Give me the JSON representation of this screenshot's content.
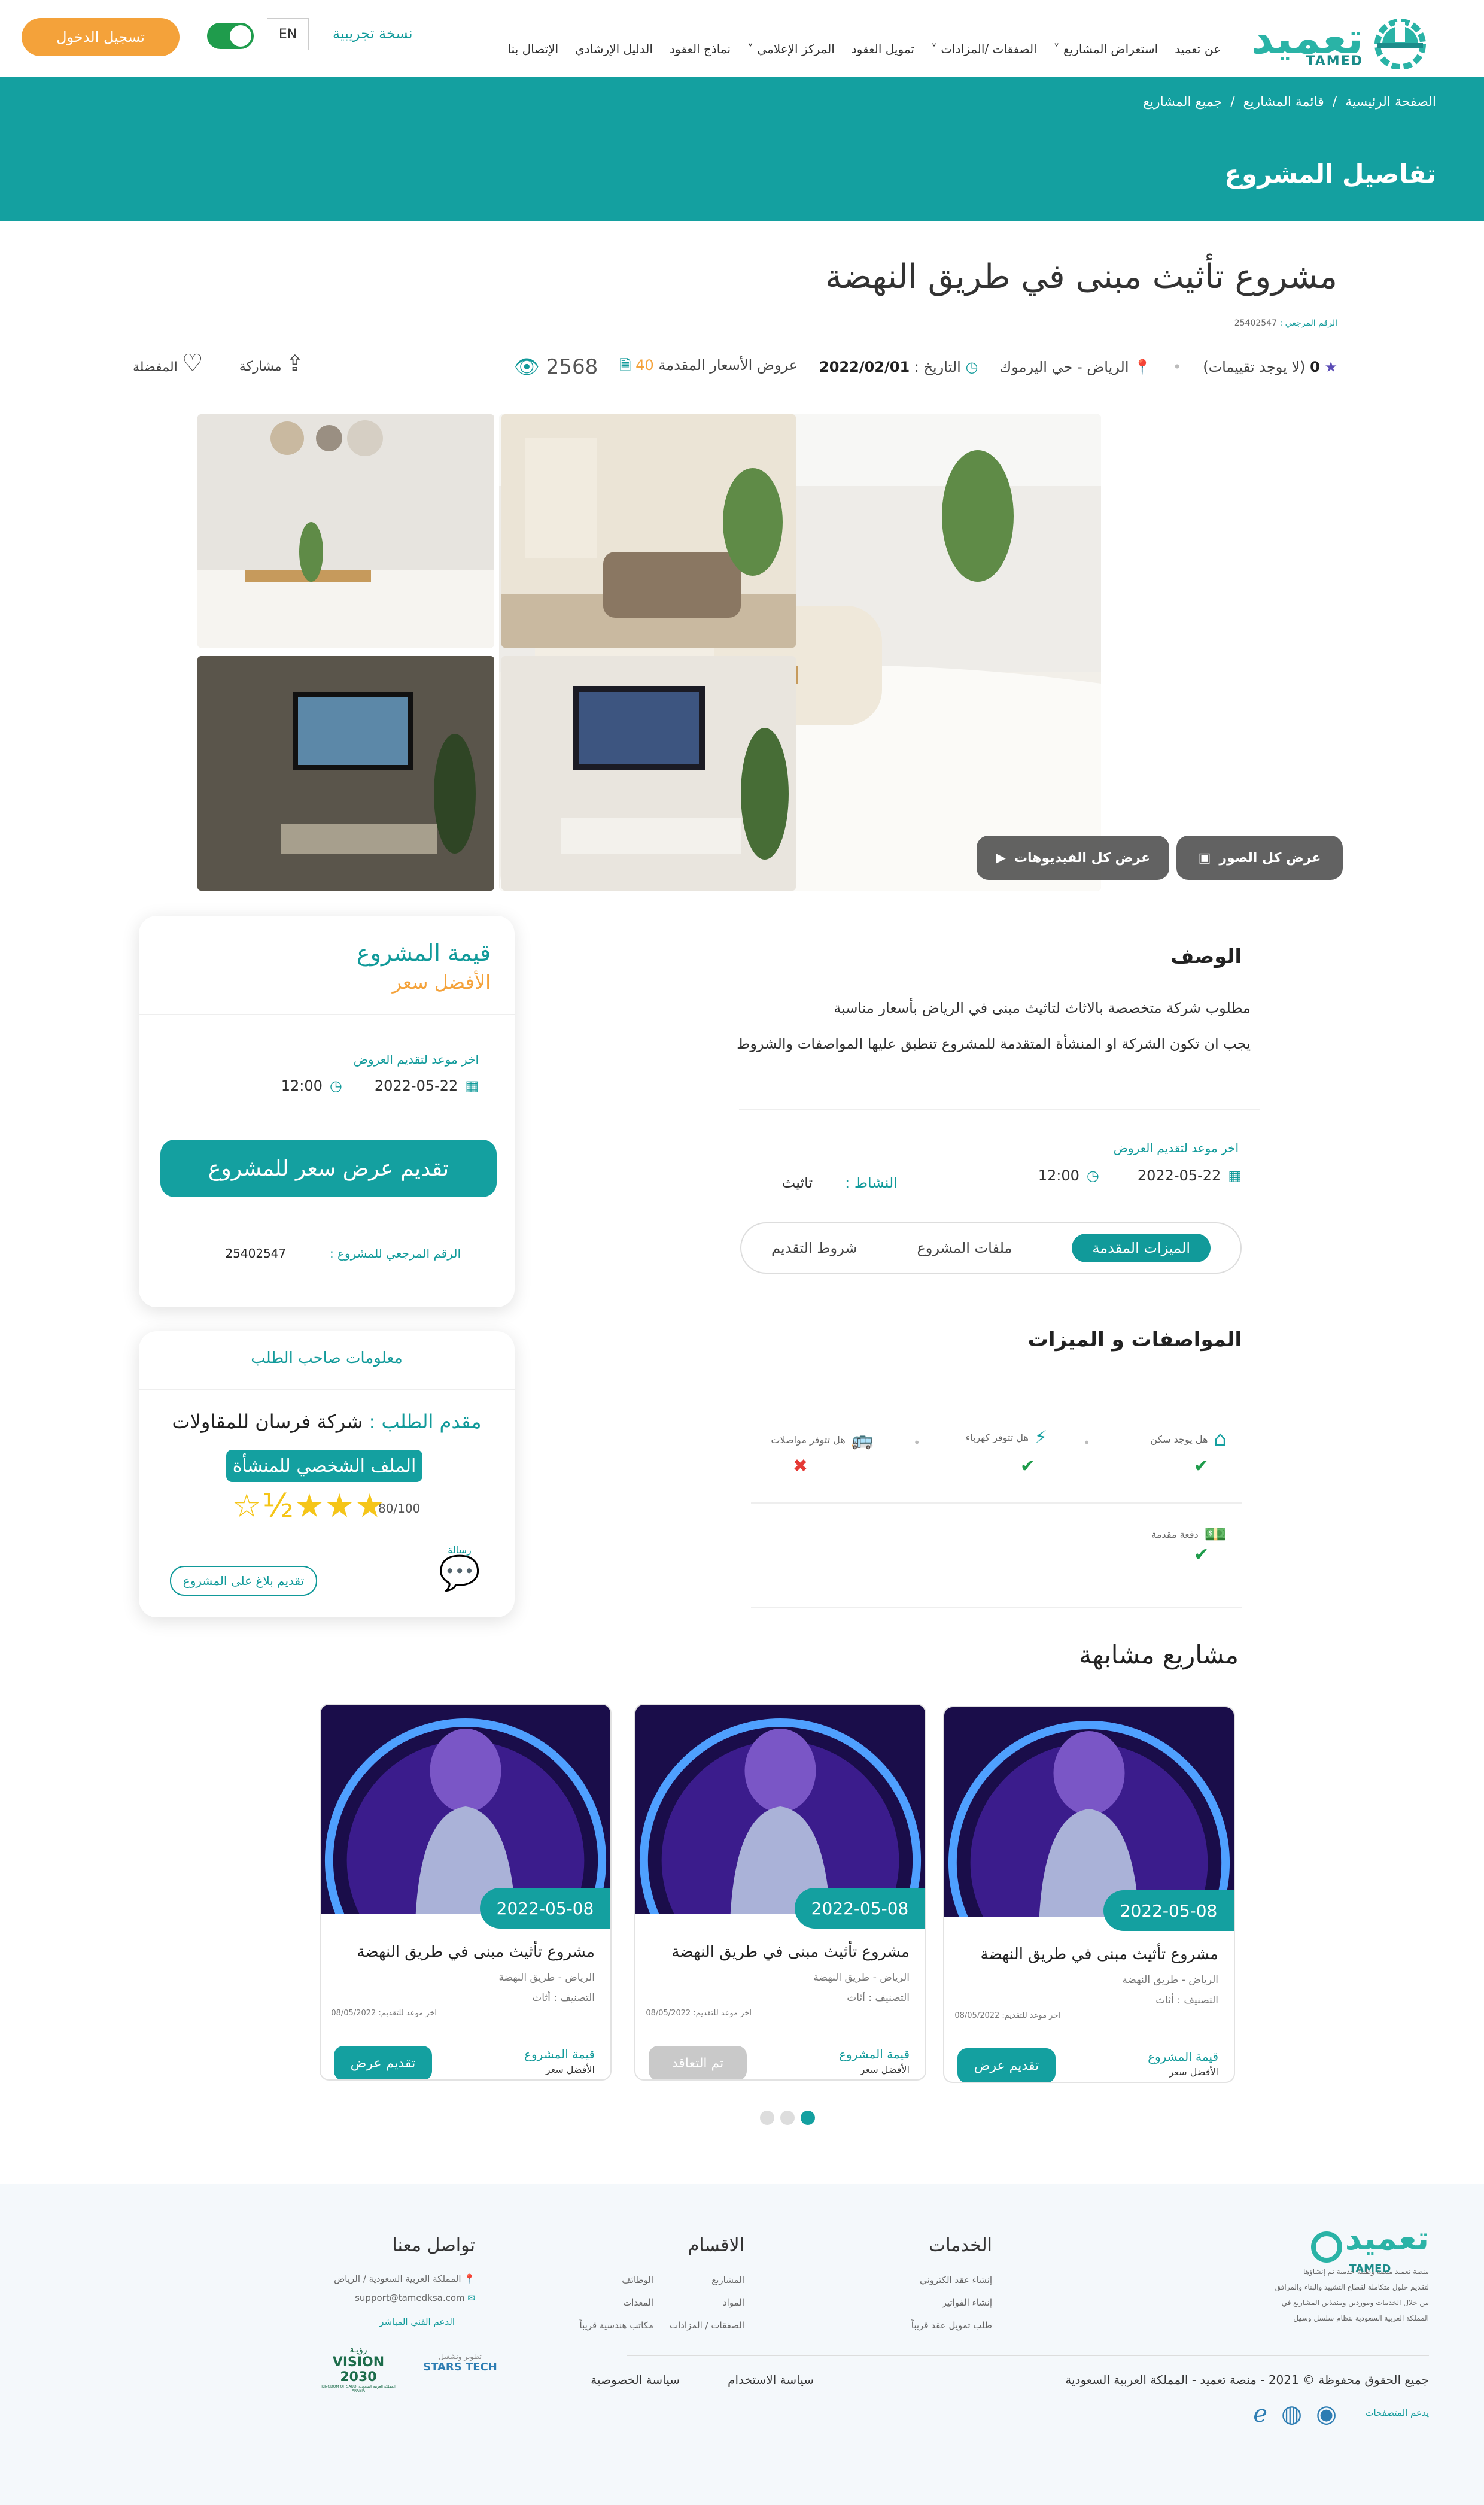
{
  "header": {
    "logo_ar": "تعميد",
    "logo_en": "TAMED",
    "nav": [
      "عن تعميد",
      "استعراض المشاريع",
      "الصفقات /المزادات",
      "تمويل العقود",
      "المركز الإعلامي",
      "نماذج العقود",
      "الدليل الإرشادي",
      "الإتصال بنا"
    ],
    "trial": "نسخة تجريبية",
    "lang": "EN",
    "login": "تسجيل الدخول"
  },
  "banner": {
    "breadcrumb": [
      "الصفحة الرئيسية",
      "قائمة المشاريع",
      "جميع المشاريع"
    ],
    "title": "تفاصيل المشروع"
  },
  "project": {
    "title": "مشروع تأثيث مبنى في طريق النهضة",
    "ref_label": "الرقم المرجعي :",
    "ref": "25402547",
    "rating": "0",
    "rating_text": "(لا يوجد تقييمات)",
    "location": "الرياض - حي اليرموك",
    "date_label": "التاريخ :",
    "date": "2022/02/01",
    "offers_label": "عروض الأسعار المقدمة",
    "offers": "40",
    "views": "2568",
    "favorite": "المفضلة",
    "share": "مشاركة",
    "show_photos": "عرض كل الصور",
    "show_videos": "عرض كل الفيديوهات"
  },
  "description": {
    "title": "الوصف",
    "line1": "مطلوب شركة متخصصة بالاثاث لتاثيث مبنى في الرياض بأسعار مناسبة",
    "line2": "يجب ان تكون الشركة او المنشأة المتقدمة للمشروع تنطبق عليها المواصفات والشروط",
    "deadline_label": "اخر موعد لتقديم العروض",
    "deadline_date": "2022-05-22",
    "deadline_time": "12:00",
    "activity_label": "النشاط :",
    "activity": "تاثيث",
    "tabs": [
      "الميزات المقدمة",
      "ملفات المشروع",
      "شروط التقديم"
    ]
  },
  "features": {
    "title": "المواصفات و الميزات",
    "items": [
      {
        "label": "هل يوجد سكن",
        "ok": "✔"
      },
      {
        "label": "هل تتوفر كهرباء",
        "ok": "✔"
      },
      {
        "label": "هل تتوفر مواصلات",
        "ok": "✖"
      },
      {
        "label": "دفعة مقدمة",
        "ok": "✔"
      }
    ]
  },
  "sidebar": {
    "value_label": "قيمة المشروع",
    "value": "الأفضل سعر",
    "deadline_label": "اخر موعد لتقديم العروض",
    "deadline_date": "2022-05-22",
    "deadline_time": "12:00",
    "cta": "تقديم عرض سعر للمشروع",
    "ref_label": "الرقم المرجعي للمشروع :",
    "ref": "25402547",
    "owner_title": "معلومات صاحب الطلب",
    "applicant_label": "مقدم الطلب :",
    "applicant": "شركة فرسان للمقاولات",
    "profile": "الملف الشخصي للمنشأة",
    "score": "80/100",
    "stars": "★★★½☆",
    "message": "رسالة",
    "report": "تقديم بلاغ على المشروع"
  },
  "similar": {
    "title": "مشاريع مشابهة",
    "cards": [
      {
        "date": "2022-05-08",
        "title": "مشروع تأثيث مبنى في طريق النهضة",
        "loc": "الرياض - طريق النهضة",
        "cat": "التصنيف : أثاث",
        "deadline": "اخر موعد للتقديم: 08/05/2022",
        "value_label": "قيمة المشروع",
        "value": "الأفضل سعر",
        "button": "تقديم عرض"
      },
      {
        "date": "2022-05-08",
        "title": "مشروع تأثيث مبنى في طريق النهضة",
        "loc": "الرياض - طريق النهضة",
        "cat": "التصنيف : أثاث",
        "deadline": "اخر موعد للتقديم: 08/05/2022",
        "value_label": "قيمة المشروع",
        "value": "الأفضل سعر",
        "button": "تم التعاقد"
      },
      {
        "date": "2022-05-08",
        "title": "مشروع تأثيث مبنى في طريق النهضة",
        "loc": "الرياض - طريق النهضة",
        "cat": "التصنيف : أثاث",
        "deadline": "اخر موعد للتقديم: 08/05/2022",
        "value_label": "قيمة المشروع",
        "value": "الأفضل سعر",
        "button": "تقديم عرض"
      }
    ]
  },
  "footer": {
    "about": [
      "منصة تعميد منصة وطنية خدمية تم إنشاؤها",
      "لتقديم حلول متكاملة لقطاع التشييد والبناء والمرافق",
      "من خلال الخدمات وموردين ومنفذين المشاريع في",
      "المملكة العربية السعودية بنظام سلسل وسهل"
    ],
    "services_title": "الخدمات",
    "services": [
      "إنشاء عقد الكتروني",
      "إنشاء الفواتير",
      "طلب تمويل عقد  قريباً"
    ],
    "sections_title": "الاقسام",
    "sections_col1": [
      "المشاريع",
      "المواد",
      "الصفقات / المزادات"
    ],
    "sections_col2": [
      "الوظائف",
      "المعدات",
      "مكاتب هندسية  قريباً"
    ],
    "contact_title": "تواصل معنا",
    "contact": [
      "المملكة العربية السعودية / الرياض",
      "support@tamedksa.com",
      "الدعم الفني المباشر"
    ],
    "copyright": "جميع الحقوق محفوظة © 2021 - منصة تعميد - المملكة العربية السعودية",
    "usage": "سياسة الاستخدام",
    "privacy": "سياسة الخصوصية",
    "browsers": "يدعم المتصفحات",
    "stars_tech": "STARS TECH",
    "stars_tech_sub": "تطوير وتشغيل",
    "vision": "VISION 2030",
    "vision_ar": "رؤيـة",
    "vision_sub": "المملكة العربية السعودية KINGDOM OF SAUDI ARABIA"
  },
  "colors": {
    "teal": "#14a0a0",
    "orange": "#f4a23a",
    "green": "#1f9c4c"
  }
}
